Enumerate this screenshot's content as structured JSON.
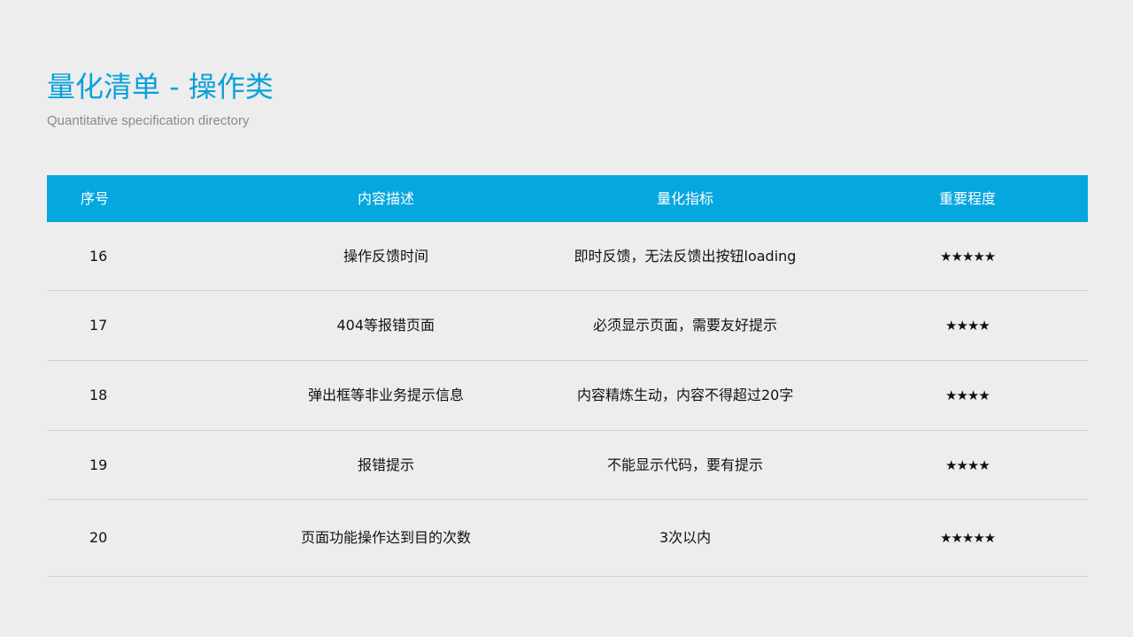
{
  "title": "量化清单 - 操作类",
  "subtitle": "Quantitative specification directory",
  "table": {
    "headers": [
      "序号",
      "内容描述",
      "量化指标",
      "重要程度"
    ],
    "rows": [
      {
        "no": "16",
        "desc": "操作反馈时间",
        "metric": "即时反馈，无法反馈出按钮loading",
        "importance": "★★★★★"
      },
      {
        "no": "17",
        "desc": "404等报错页面",
        "metric": "必须显示页面，需要友好提示",
        "importance": "★★★★"
      },
      {
        "no": "18",
        "desc": "弹出框等非业务提示信息",
        "metric": "内容精炼生动，内容不得超过20字",
        "importance": "★★★★"
      },
      {
        "no": "19",
        "desc": "报错提示",
        "metric": "不能显示代码，要有提示",
        "importance": "★★★★"
      },
      {
        "no": "20",
        "desc": "页面功能操作达到目的次数",
        "metric": "3次以内",
        "importance": "★★★★★"
      }
    ]
  }
}
